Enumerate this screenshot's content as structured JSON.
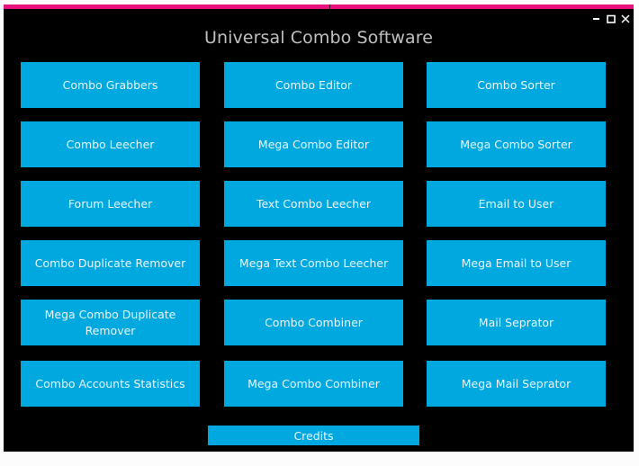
{
  "window": {
    "title": "Universal Combo Software",
    "accent_color": "#e8127c",
    "button_color": "#00a8e0",
    "controls": {
      "minimize_icon": "minimize-icon",
      "maximize_icon": "maximize-icon",
      "close_icon": "close-icon"
    }
  },
  "buttons": {
    "rows": [
      [
        "Combo Grabbers",
        "Combo Editor",
        "Combo Sorter"
      ],
      [
        "Combo Leecher",
        "Mega Combo Editor",
        "Mega Combo Sorter"
      ],
      [
        "Forum Leecher",
        "Text Combo Leecher",
        "Email to User"
      ],
      [
        "Combo Duplicate Remover",
        "Mega Text Combo Leecher",
        "Mega Email to User"
      ],
      [
        "Mega Combo Duplicate Remover",
        "Combo Combiner",
        "Mail Seprator"
      ],
      [
        "Combo Accounts Statistics",
        "Mega Combo Combiner",
        "Mega Mail Seprator"
      ]
    ],
    "credits": "Credits"
  }
}
